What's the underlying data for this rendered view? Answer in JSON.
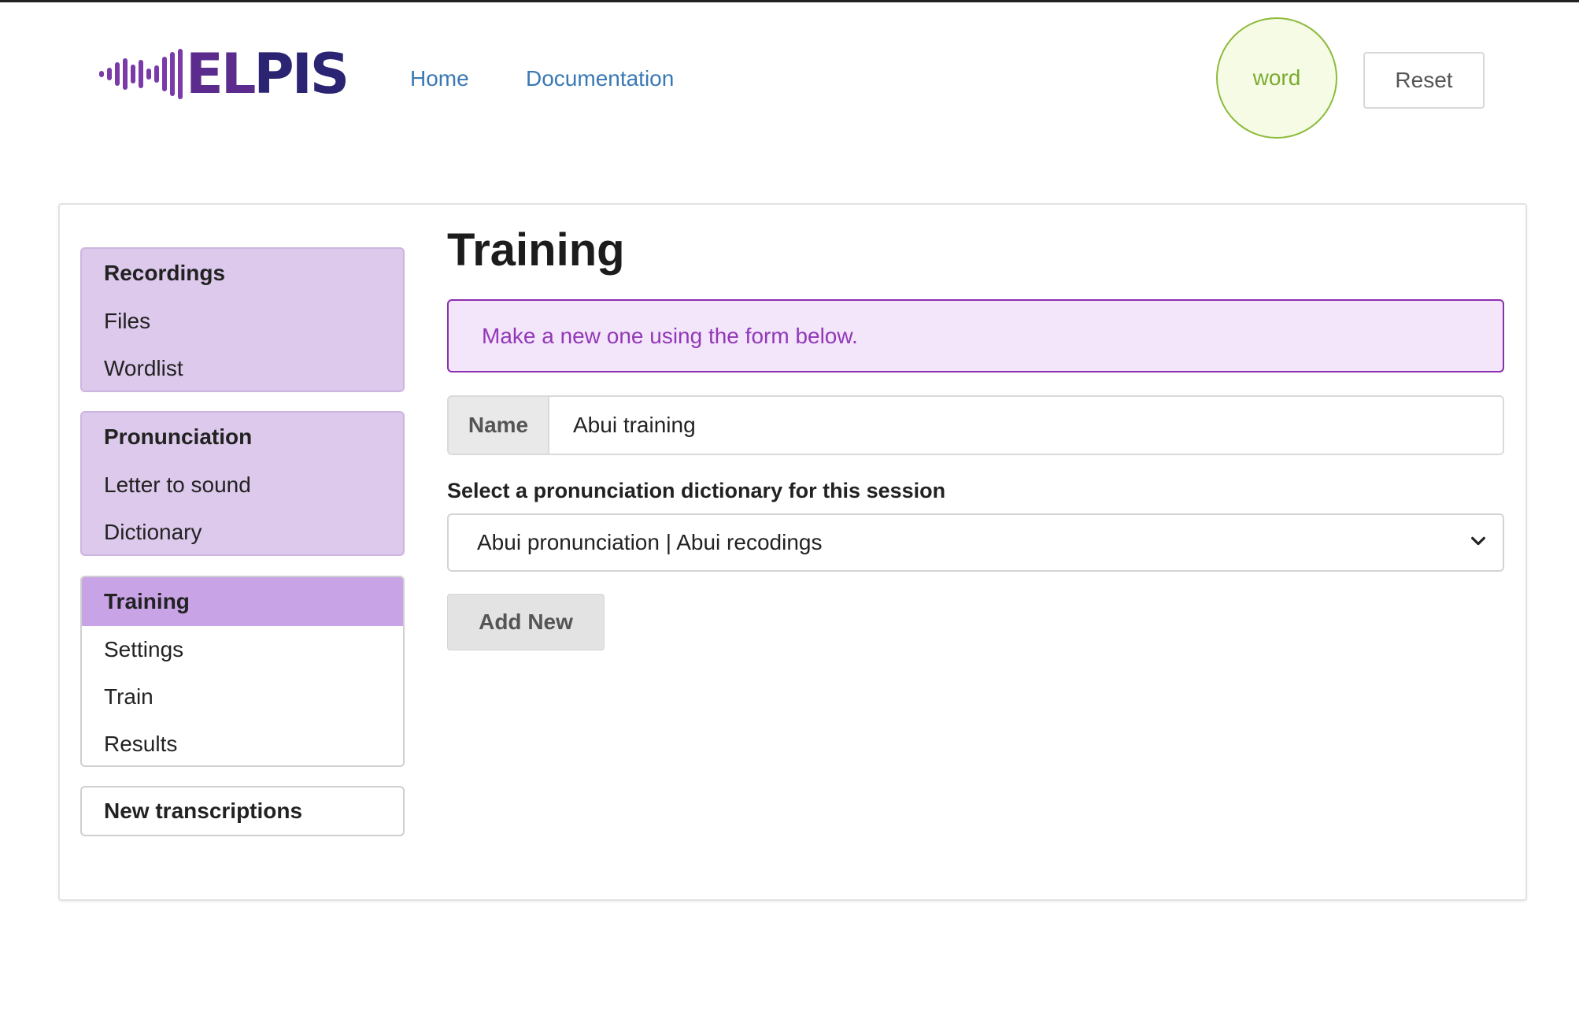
{
  "brand": {
    "logo_text": "ELPIS",
    "colors": {
      "logo_dark": "#2a2472",
      "logo_purple": "#5b2c8e"
    }
  },
  "nav": {
    "home_label": "Home",
    "docs_label": "Documentation"
  },
  "header": {
    "mode_badge": "word",
    "reset_label": "Reset"
  },
  "sidebar": {
    "groups": [
      {
        "title": "Recordings",
        "items": [
          "Files",
          "Wordlist"
        ]
      },
      {
        "title": "Pronunciation",
        "items": [
          "Letter to sound",
          "Dictionary"
        ]
      },
      {
        "title": "Training",
        "items": [
          "Settings",
          "Train",
          "Results"
        ]
      },
      {
        "title": "New transcriptions",
        "items": []
      }
    ],
    "active_group": "Training"
  },
  "main": {
    "title": "Training",
    "info_message": "Make a new one using the form below.",
    "name_label": "Name",
    "name_value": "Abui training",
    "select_label": "Select a pronunciation dictionary for this session",
    "select_value": "Abui pronunciation | Abui recodings",
    "add_button": "Add New"
  },
  "icons": {
    "select_chevron": "chevron-down-icon"
  },
  "theme": {
    "accent": "#8a2fb0",
    "menu_tint": "#dcc9eb",
    "menu_active": "#c8a3e6",
    "link": "#3a78b5",
    "badge_green": "#8dbb3c"
  }
}
